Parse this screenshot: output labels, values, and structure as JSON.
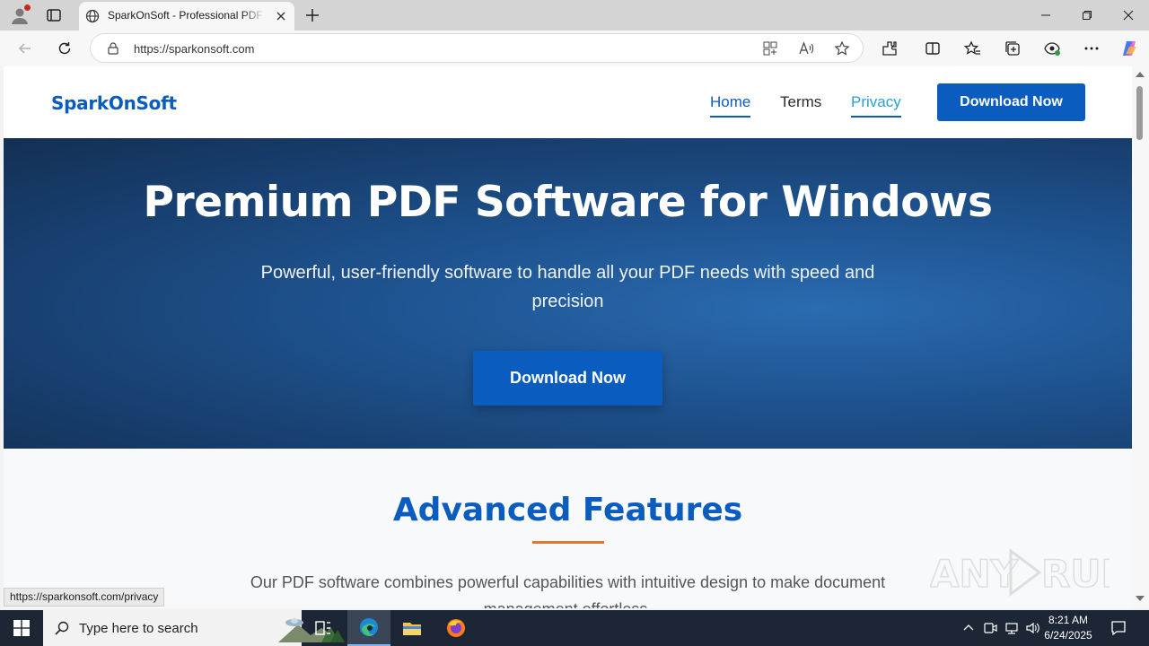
{
  "browser": {
    "tab_title": "SparkOnSoft - Professional PDF Software for Windows",
    "url": "https://sparkonsoft.com",
    "status_url": "https://sparkonsoft.com/privacy"
  },
  "site": {
    "logo": "SparkOnSoft",
    "nav": [
      {
        "label": "Home"
      },
      {
        "label": "Terms"
      },
      {
        "label": "Privacy"
      }
    ],
    "header_cta": "Download Now",
    "hero": {
      "title": "Premium PDF Software for Windows",
      "subtitle": "Powerful, user-friendly software to handle all your PDF needs with speed and precision",
      "cta": "Download Now"
    },
    "features": {
      "heading": "Advanced Features",
      "text": "Our PDF software combines powerful capabilities with intuitive design to make document management effortless."
    }
  },
  "taskbar": {
    "search_placeholder": "Type here to search",
    "time": "8:21 AM",
    "date": "6/24/2025"
  },
  "watermark": "ANY RUN",
  "colors": {
    "brand_blue": "#0b5cbf",
    "accent_orange": "#e8742c",
    "hero_dark": "#132f52"
  }
}
